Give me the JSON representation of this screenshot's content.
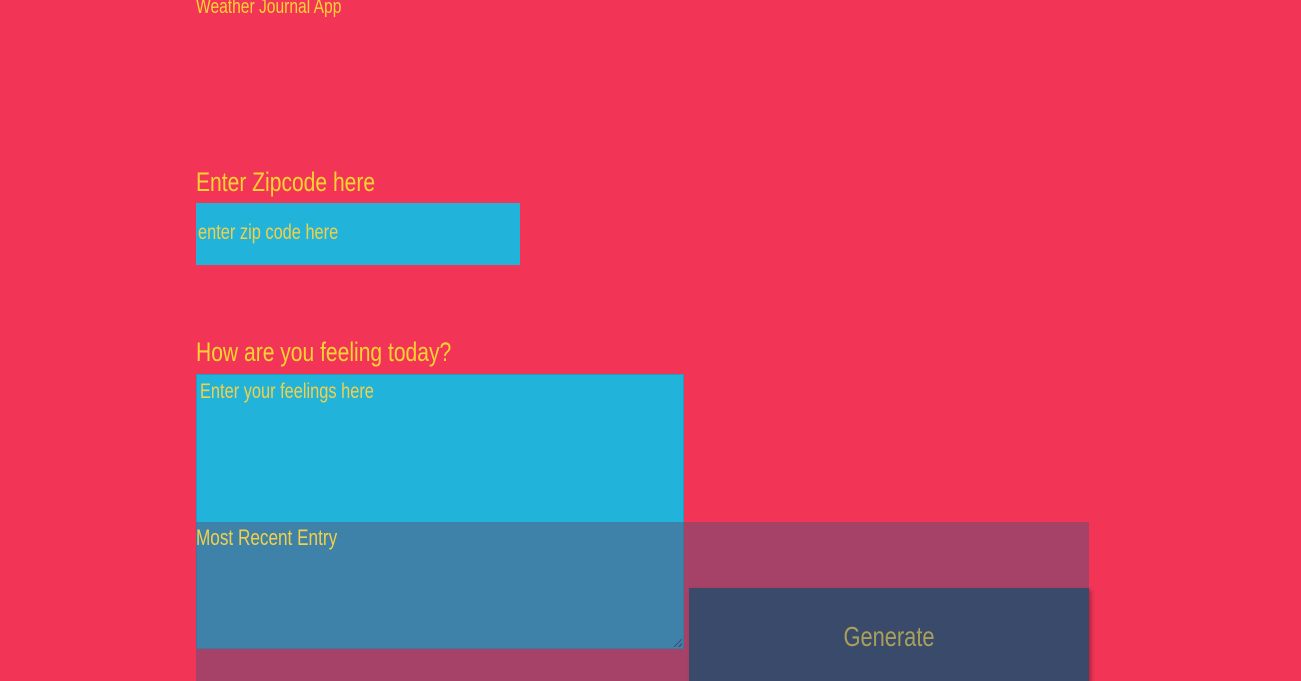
{
  "app": {
    "title": "Weather Journal App"
  },
  "zip": {
    "label": "Enter Zipcode here",
    "placeholder": "enter zip code here",
    "value": ""
  },
  "feelings": {
    "label": "How are you feeling today?",
    "placeholder": "Enter your feelings here",
    "value": ""
  },
  "recent": {
    "title": "Most Recent Entry"
  },
  "actions": {
    "generate_label": "Generate"
  },
  "colors": {
    "background": "#f23456",
    "accent_text": "#fcd430",
    "input_background": "#22b3da",
    "button_background": "#3a4a6b"
  }
}
